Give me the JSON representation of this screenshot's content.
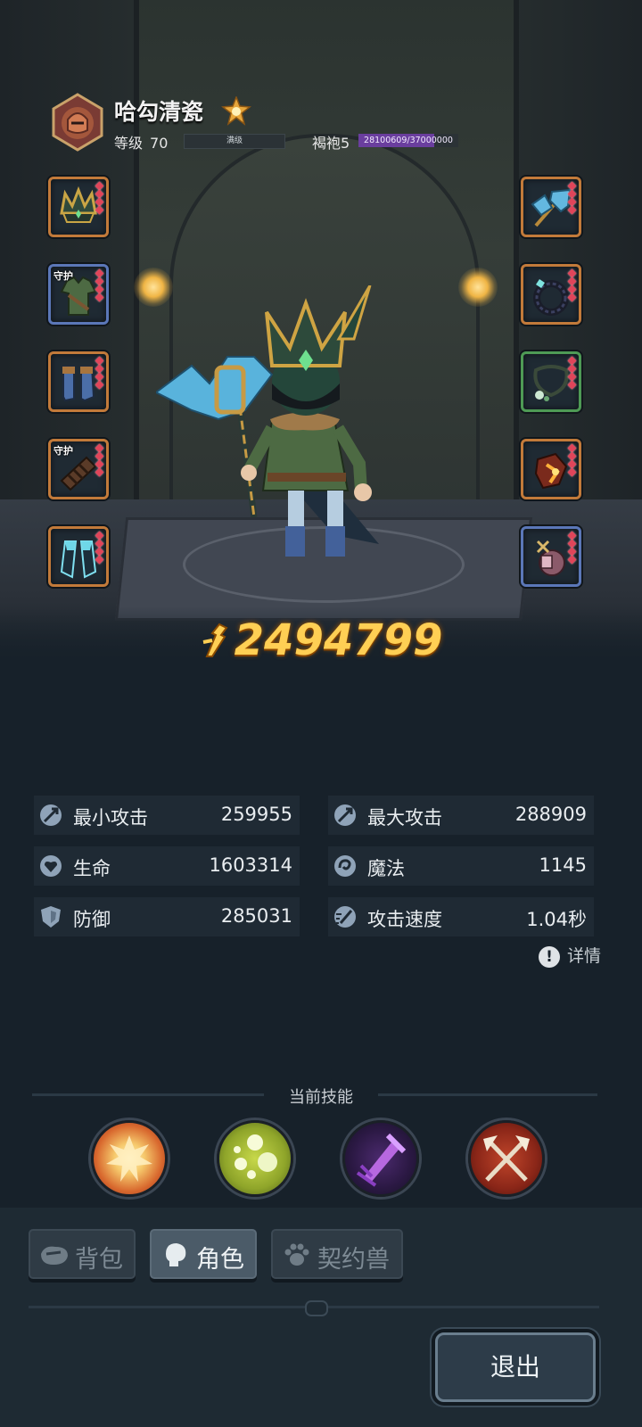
{
  "player": {
    "name": "哈勾清瓷",
    "level_label": "等级",
    "level": "70",
    "level_status": "满级",
    "rank": "褐袍5",
    "rank_progress_text": "28100609/37000000",
    "rank_progress": 0.759
  },
  "equipment": {
    "left": [
      {
        "name": "crown",
        "frame": "orange",
        "guard": ""
      },
      {
        "name": "tunic",
        "frame": "blue",
        "guard": "守护"
      },
      {
        "name": "boots",
        "frame": "orange",
        "guard": ""
      },
      {
        "name": "bracers",
        "frame": "orange",
        "guard": "守护"
      },
      {
        "name": "cape",
        "frame": "orange",
        "guard": ""
      }
    ],
    "right": [
      {
        "name": "staff",
        "frame": "orange",
        "guard": ""
      },
      {
        "name": "ring",
        "frame": "orange",
        "guard": ""
      },
      {
        "name": "necklace",
        "frame": "green",
        "guard": ""
      },
      {
        "name": "charm",
        "frame": "orange",
        "guard": ""
      },
      {
        "name": "potion-pouch",
        "frame": "blue",
        "guard": ""
      }
    ]
  },
  "power": "2494799",
  "stats": {
    "min_attack": {
      "label": "最小攻击",
      "value": "259955"
    },
    "max_attack": {
      "label": "最大攻击",
      "value": "288909"
    },
    "hp": {
      "label": "生命",
      "value": "1603314"
    },
    "magic": {
      "label": "魔法",
      "value": "1145"
    },
    "defense": {
      "label": "防御",
      "value": "285031"
    },
    "attack_speed": {
      "label": "攻击速度",
      "value": "1.04秒"
    }
  },
  "details_label": "详情",
  "skills": {
    "title": "当前技能",
    "items": [
      "explosion-skill-icon",
      "poison-orbs-skill-icon",
      "shadow-strike-skill-icon",
      "crossed-axes-skill-icon"
    ]
  },
  "tabs": [
    {
      "label": "背包",
      "active": false
    },
    {
      "label": "角色",
      "active": true
    },
    {
      "label": "契约兽",
      "active": false
    }
  ],
  "exit_label": "退出",
  "colors": {
    "power": "#ffcf54",
    "slot_orange": "#c27a3a",
    "slot_blue": "#5b77b8",
    "slot_green": "#4e9a55",
    "rank_bar": "#6a3e9e"
  }
}
